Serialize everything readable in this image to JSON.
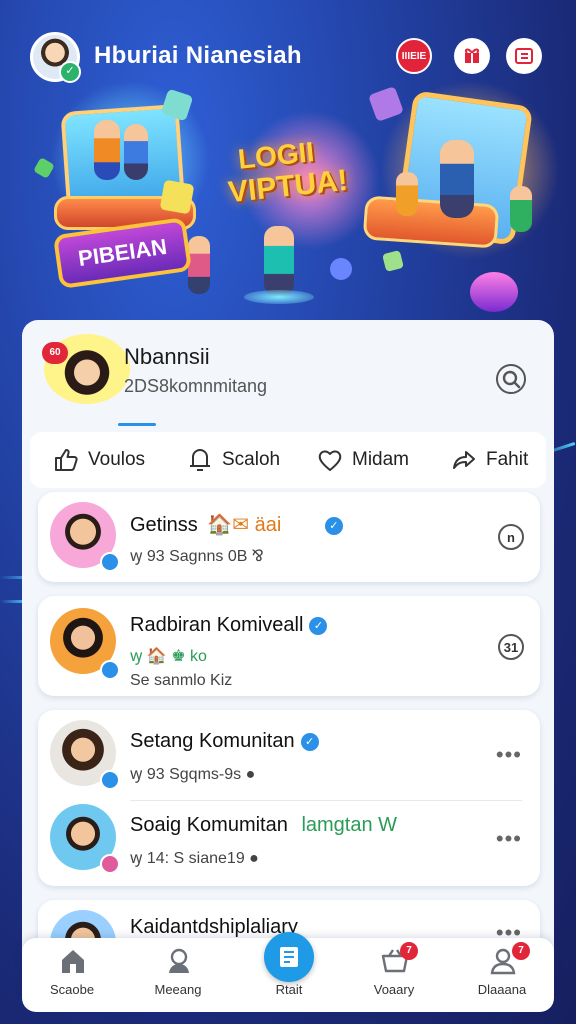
{
  "header": {
    "title": "Hburiai Nianesiah",
    "live_label": "IIIEIE",
    "status_badge": "✓"
  },
  "hero": {
    "headline_1": "LOGII",
    "headline_2": "VIPTUA!",
    "banner_label": "PIBEIAN"
  },
  "profile": {
    "name": "Nbannsii",
    "subtitle": "2DS8komnmitang",
    "badge": "60"
  },
  "tabs": [
    {
      "label": "Voulos",
      "icon": "thumbs-up-icon"
    },
    {
      "label": "Scaloh",
      "icon": "bell-icon"
    },
    {
      "label": "Midam",
      "icon": "heart-icon"
    },
    {
      "label": "Fahit",
      "icon": "share-icon"
    }
  ],
  "communities": [
    {
      "name": "Getinss",
      "badges": "🏠✉ äai",
      "sub": "ꝡ 93 Sagnns 0B ⅋",
      "action": "n"
    },
    {
      "name": "Radbiran Komiveall",
      "badges": "",
      "sub_top": "ꝡ 🏠 ♚ ko",
      "sub": "Se sanmlo Kiz",
      "action": "31"
    },
    {
      "name": "Setang Komunitan",
      "badges": "",
      "sub": "ꝡ 93 Sgqms-9s ●",
      "action": "•••"
    },
    {
      "name": "Soaig Komumitan",
      "badges": "lamgtan W",
      "sub": "ꝡ 14: S siane19 ●",
      "action": "•••"
    },
    {
      "name": "Kaidantdshiplaliary",
      "badges": "",
      "sub": "",
      "action": "•••"
    }
  ],
  "nav": [
    {
      "label": "Scaobe",
      "icon": "home-icon"
    },
    {
      "label": "Meeang",
      "icon": "group-icon"
    },
    {
      "label": "Rtait",
      "icon": "post-icon"
    },
    {
      "label": "Voaary",
      "icon": "basket-icon",
      "badge": "7"
    },
    {
      "label": "Dlaaana",
      "icon": "profile-icon",
      "badge": "7"
    }
  ],
  "colors": {
    "accent": "#2b90e8",
    "live": "#e2243a",
    "verified": "#2b90e8",
    "badge": "#e02638"
  }
}
